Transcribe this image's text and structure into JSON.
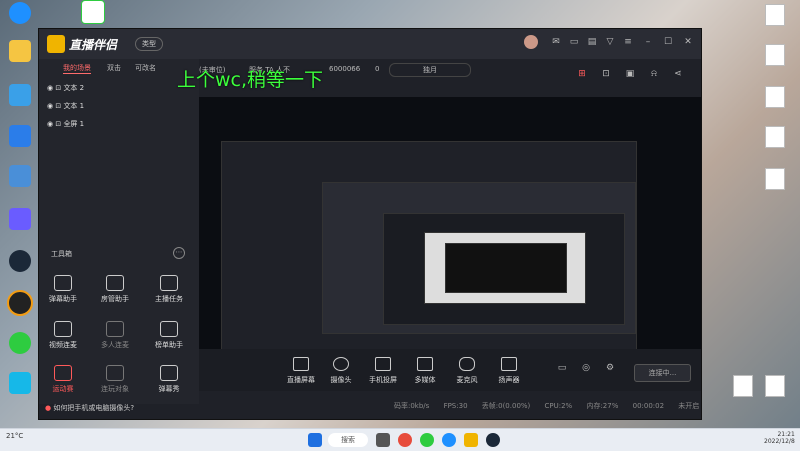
{
  "desktop": {
    "left_icons": [
      "",
      "",
      "",
      "",
      "",
      "",
      "",
      "",
      "",
      ""
    ],
    "right_icons": [
      ""
    ]
  },
  "app": {
    "title": "直播伴侣",
    "badge": "类型",
    "tabs": [
      "我的场景",
      "双击",
      "可改名"
    ],
    "layers": [
      "文本 2",
      "文本 1",
      "全屏 1"
    ],
    "top_info": [
      "(未审位)",
      "服务 TA 人不",
      "6000066",
      "0",
      "独月"
    ],
    "overlay_text": "上个wc,稍等一下",
    "tools_header": "工具箱",
    "tools": [
      {
        "label": "弹幕助手",
        "style": ""
      },
      {
        "label": "房管助手",
        "style": ""
      },
      {
        "label": "主播任务",
        "style": ""
      },
      {
        "label": "视频连麦",
        "style": ""
      },
      {
        "label": "多人连麦",
        "style": "dim"
      },
      {
        "label": "榜单助手",
        "style": ""
      },
      {
        "label": "运动赛",
        "style": "red"
      },
      {
        "label": "连玩对象",
        "style": "dim"
      },
      {
        "label": "弹幕秀",
        "style": ""
      }
    ],
    "hint": "如何把手机或电脑摄像头?",
    "bottom_tools": [
      "直播屏幕",
      "摄像头",
      "手机投屏",
      "多媒体",
      "麦克风",
      "扬声器"
    ],
    "live_button": "连接中...",
    "status": [
      "码率:0kb/s",
      "FPS:30",
      "丢帧:0(0.00%)",
      "CPU:2%",
      "内存:27%",
      "00:00:02",
      "未开启"
    ]
  },
  "taskbar": {
    "search": "搜索",
    "weather": "21°C",
    "time": "21:21",
    "date": "2022/12/8"
  },
  "colors": {
    "accent": "#ff5a5a",
    "overlay_green": "#3cff3c",
    "logo": "#f0b400"
  }
}
